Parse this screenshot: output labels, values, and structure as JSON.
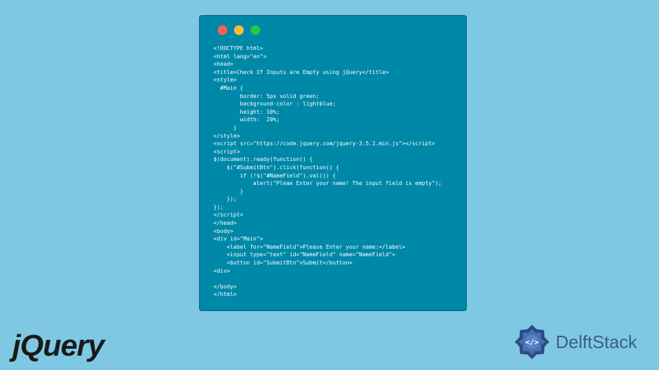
{
  "code_lines": [
    "<!DOCTYPE html>",
    "<html lang=\"en\">",
    "<head>",
    "<title>Check If Inputs are Empty using jQuery</title>",
    "<style>",
    "  #Main {",
    "        border: 5px solid green;",
    "        background-color : lightblue;",
    "        height: 10%;",
    "        width:  20%;",
    "      }",
    "</style>",
    "<script src=\"https://code.jquery.com/jquery-3.5.1.min.js\"></script>",
    "<script>",
    "$(document).ready(function() {",
    "    $(\"#SubmitBtn\").click(function() {",
    "        if (!$(\"#NameField\").val()) {",
    "            alert(\"Pleae Enter your name! The input field is empty\");",
    "        }",
    "    });",
    "});",
    "</script>",
    "</head>",
    "<body>",
    "<div id=\"Main\">",
    "    <label for=\"NameField\">Please Enter your name:</label>",
    "    <input type=\"text\" id=\"NameField\" name=\"NameField\">",
    "    <button id=\"SubmitBtn\">Submit</button>",
    "<div>",
    "",
    "</body>",
    "</html>"
  ],
  "logos": {
    "jquery": "jQuery",
    "delftstack": "DelftStack"
  }
}
